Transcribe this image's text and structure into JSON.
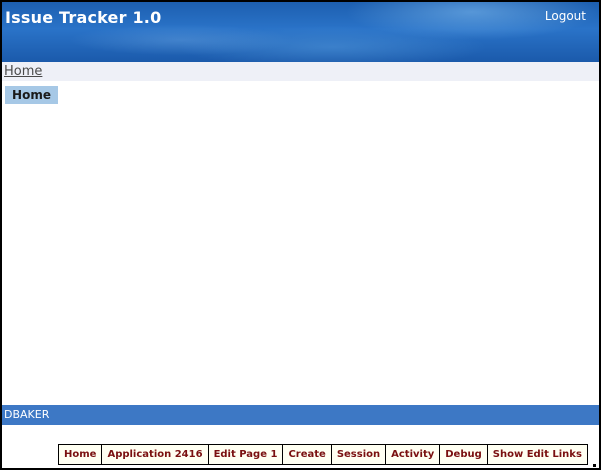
{
  "header": {
    "app_title": "Issue Tracker 1.0",
    "logout_label": "Logout"
  },
  "breadcrumb": {
    "home_label": "Home"
  },
  "region": {
    "tab_label": "Home"
  },
  "footer": {
    "username": "DBAKER"
  },
  "dev_toolbar": {
    "items": [
      {
        "label": "Home"
      },
      {
        "label": "Application 2416"
      },
      {
        "label": "Edit Page 1"
      },
      {
        "label": "Create"
      },
      {
        "label": "Session"
      },
      {
        "label": "Activity"
      },
      {
        "label": "Debug"
      },
      {
        "label": "Show Edit Links"
      }
    ]
  },
  "colors": {
    "header_blue": "#2a73c8",
    "footer_blue": "#3d78c5",
    "toolbar_text": "#7a1010",
    "tab_bg": "#a6c8e6"
  }
}
